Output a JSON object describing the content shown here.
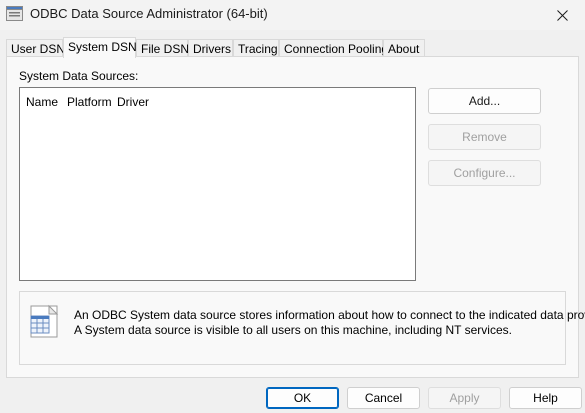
{
  "window": {
    "title": "ODBC Data Source Administrator (64-bit)",
    "icon": "odbc-app-icon",
    "close_icon": "close-icon"
  },
  "tabs": [
    {
      "label": "User DSN",
      "active": false
    },
    {
      "label": "System DSN",
      "active": true
    },
    {
      "label": "File DSN",
      "active": false
    },
    {
      "label": "Drivers",
      "active": false
    },
    {
      "label": "Tracing",
      "active": false
    },
    {
      "label": "Connection Pooling",
      "active": false
    },
    {
      "label": "About",
      "active": false
    }
  ],
  "system_dsn": {
    "section_label": "System Data Sources:",
    "columns": [
      "Name",
      "Platform",
      "Driver"
    ],
    "rows": [],
    "buttons": {
      "add": {
        "label": "Add...",
        "enabled": true
      },
      "remove": {
        "label": "Remove",
        "enabled": false
      },
      "configure": {
        "label": "Configure...",
        "enabled": false
      }
    },
    "info": {
      "icon": "database-info-icon",
      "line1": "An ODBC System data source stores information about how to connect to the indicated data provider.",
      "line2": "A System data source is visible to all users on this machine, including NT services."
    }
  },
  "footer": {
    "ok": {
      "label": "OK",
      "enabled": true
    },
    "cancel": {
      "label": "Cancel",
      "enabled": true
    },
    "apply": {
      "label": "Apply",
      "enabled": false
    },
    "help": {
      "label": "Help",
      "enabled": true
    }
  },
  "colors": {
    "accent": "#0067c0",
    "disabled_text": "#a0a0a0"
  }
}
